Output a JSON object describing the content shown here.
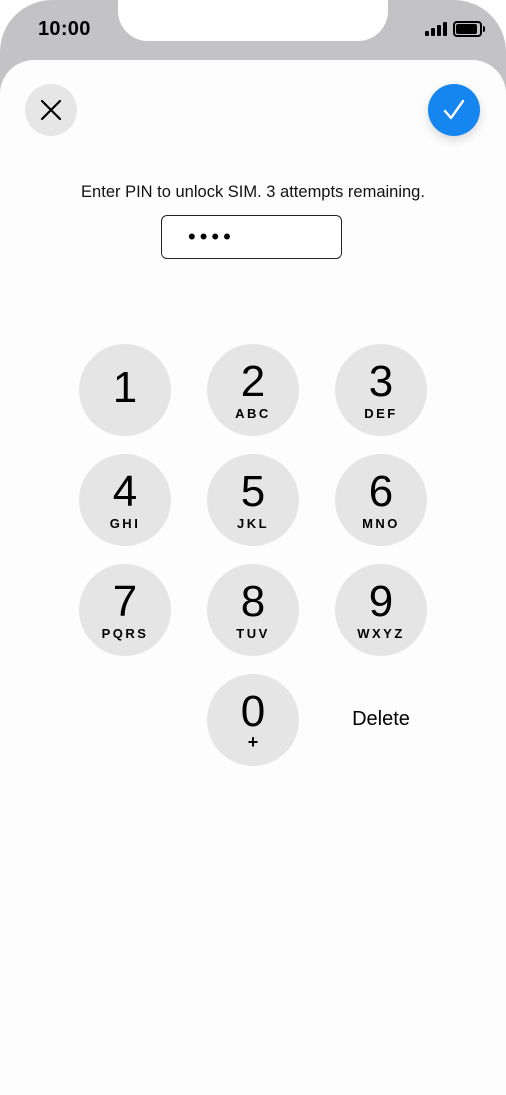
{
  "status_bar": {
    "time": "10:00"
  },
  "header": {
    "close_icon": "close-icon",
    "done_icon": "checkmark-icon"
  },
  "prompt": "Enter PIN to unlock SIM. 3 attempts remaining.",
  "pin_field": {
    "value": "••••"
  },
  "keypad": {
    "keys": [
      {
        "digit": "1",
        "letters": ""
      },
      {
        "digit": "2",
        "letters": "ABC"
      },
      {
        "digit": "3",
        "letters": "DEF"
      },
      {
        "digit": "4",
        "letters": "GHI"
      },
      {
        "digit": "5",
        "letters": "JKL"
      },
      {
        "digit": "6",
        "letters": "MNO"
      },
      {
        "digit": "7",
        "letters": "PQRS"
      },
      {
        "digit": "8",
        "letters": "TUV"
      },
      {
        "digit": "9",
        "letters": "WXYZ"
      },
      {
        "digit": "0",
        "letters": "+"
      }
    ],
    "delete_label": "Delete"
  },
  "colors": {
    "accent": "#1585f0",
    "key_bg": "#e5e5e5"
  }
}
